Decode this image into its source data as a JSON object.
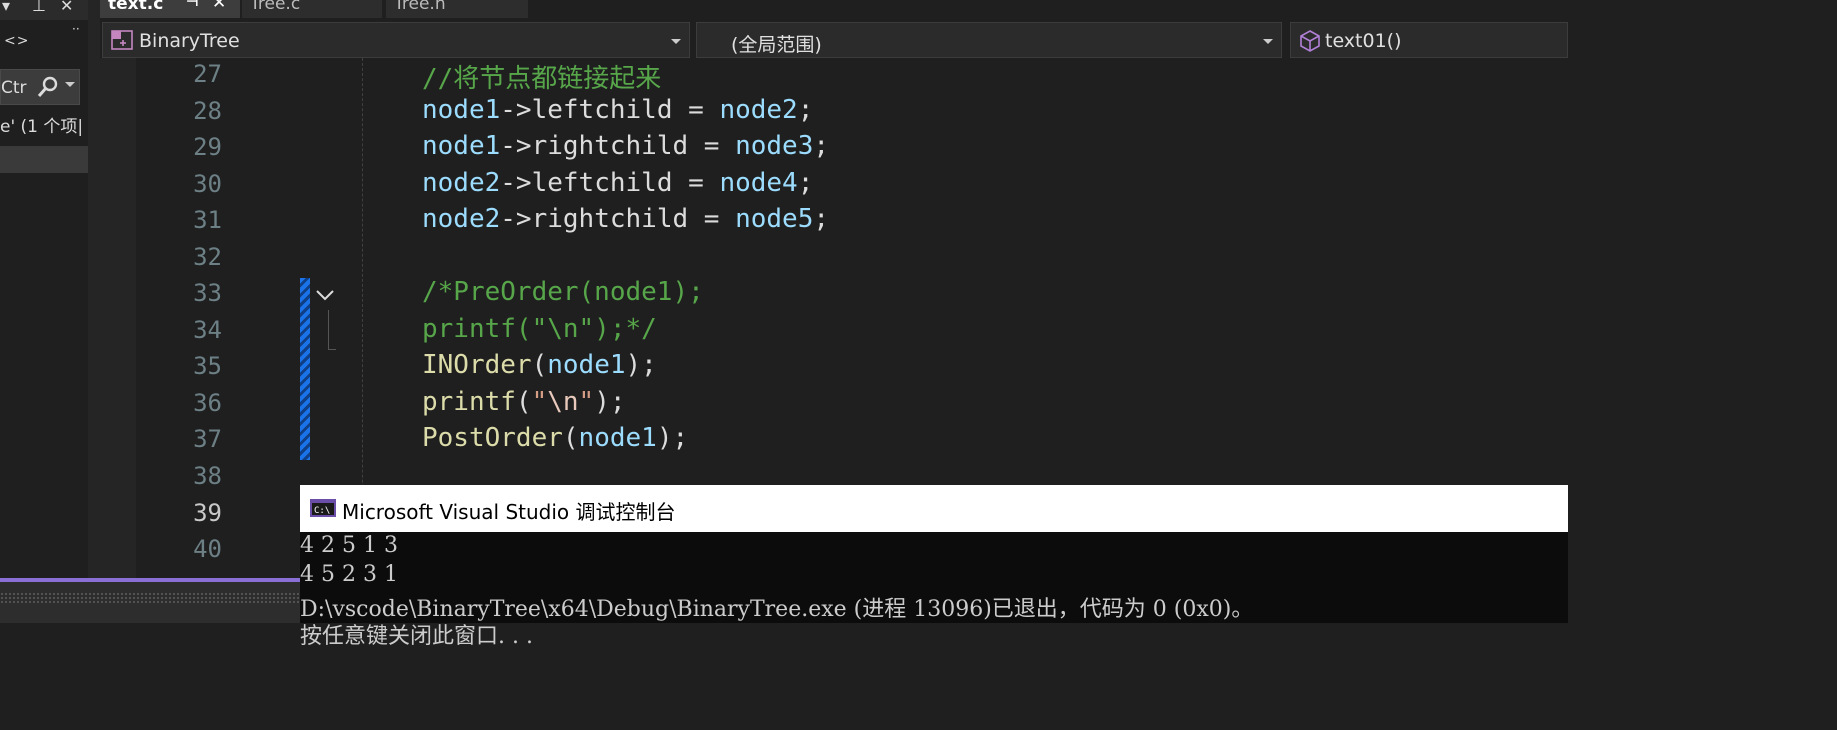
{
  "left_panel": {
    "code_icon": "<>",
    "more_icon": "··",
    "search_text": "Ctr",
    "search_icon": "search-icon",
    "result_item": "e' (1 个项|"
  },
  "tabs": [
    {
      "label": "text.c",
      "active": true
    },
    {
      "label": "Tree.c",
      "active": false
    },
    {
      "label": "Tree.h",
      "active": false
    }
  ],
  "navbar": {
    "project": "BinaryTree",
    "scope": "(全局范围)",
    "member": "text01()"
  },
  "editor": {
    "line_numbers": [
      "27",
      "28",
      "29",
      "30",
      "31",
      "32",
      "33",
      "34",
      "35",
      "36",
      "37",
      "38",
      "39",
      "40"
    ],
    "current_line": "39",
    "code": {
      "l27": "//将节点都链接起来",
      "l28_a": "node1",
      "l28_b": "->leftchild = ",
      "l28_c": "node2",
      "l28_d": ";",
      "l29_a": "node1",
      "l29_b": "->rightchild = ",
      "l29_c": "node3",
      "l29_d": ";",
      "l30_a": "node2",
      "l30_b": "->leftchild = ",
      "l30_c": "node4",
      "l30_d": ";",
      "l31_a": "node2",
      "l31_b": "->rightchild = ",
      "l31_c": "node5",
      "l31_d": ";",
      "l33": "/*PreOrder(node1);",
      "l34": "printf(\"\\n\");*/",
      "l35_a": "INOrder",
      "l35_b": "(",
      "l35_c": "node1",
      "l35_d": ");",
      "l36_a": "printf",
      "l36_b": "(",
      "l36_c": "\"",
      "l36_d": "\\n",
      "l36_e": "\"",
      "l36_f": ");",
      "l37_a": "PostOrder",
      "l37_b": "(",
      "l37_c": "node1",
      "l37_d": ");"
    }
  },
  "console": {
    "title": "Microsoft Visual Studio 调试控制台",
    "lines": [
      "4 2 5 1 3",
      "4 5 2 3 1",
      "D:\\vscode\\BinaryTree\\x64\\Debug\\BinaryTree.exe (进程 13096)已退出，代码为 0 (0x0)。",
      "按任意键关闭此窗口. . ."
    ]
  },
  "colors": {
    "comment": "#57a64a",
    "identifier": "#9cdcfe",
    "function": "#dcdcaa",
    "accent": "#8a6fd6",
    "change_marker": "#1a73e8"
  }
}
